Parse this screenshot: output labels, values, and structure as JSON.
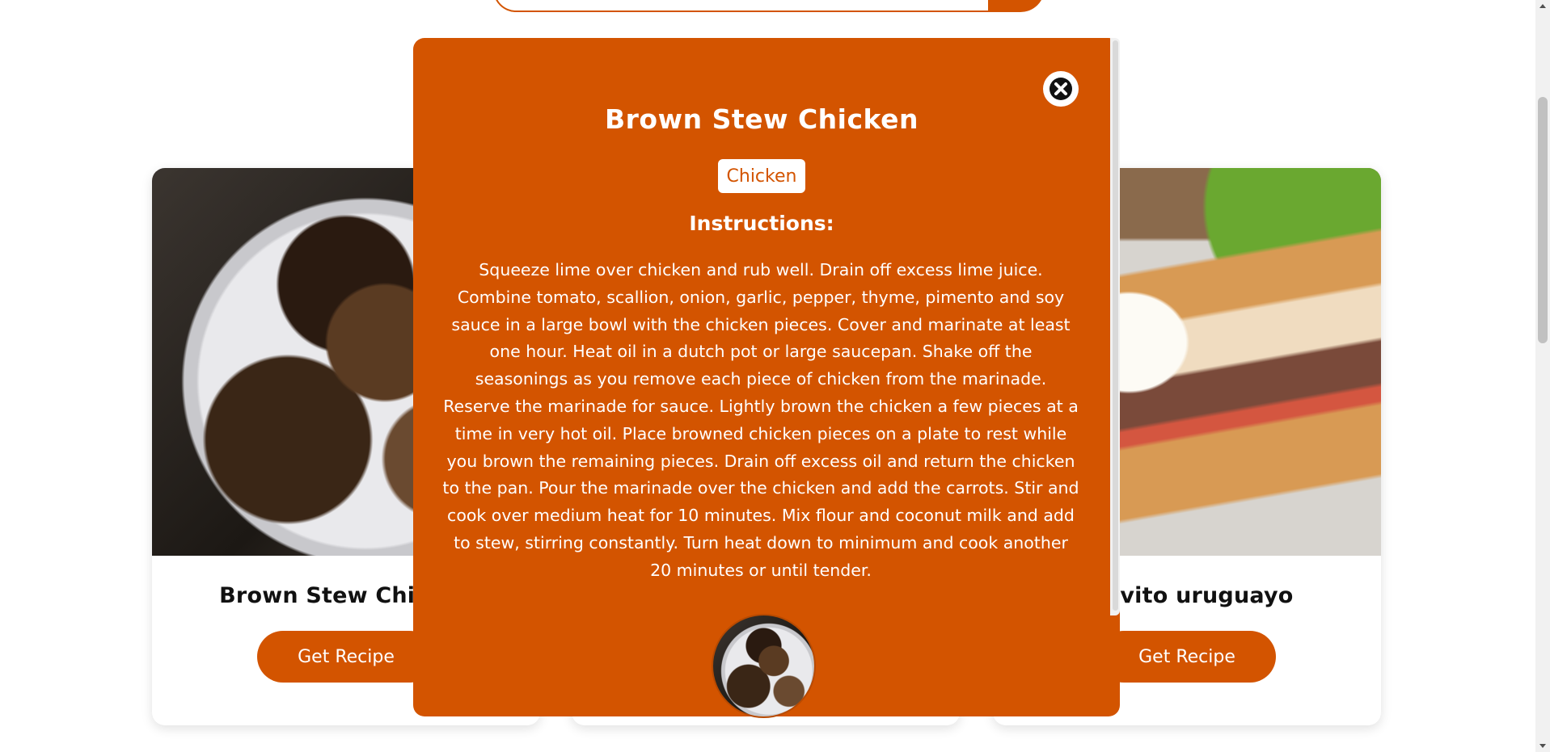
{
  "cards": [
    {
      "title": "Brown Stew Chicken",
      "button": "Get Recipe"
    },
    {
      "title": "Chivito uruguayo",
      "button": "Get Recipe"
    }
  ],
  "modal": {
    "title": "Brown Stew Chicken",
    "category": "Chicken",
    "instructions_heading": "Instructions:",
    "instructions": "Squeeze lime over chicken and rub well. Drain off excess lime juice. Combine tomato, scallion, onion, garlic, pepper, thyme, pimento and soy sauce in a large bowl with the chicken pieces. Cover and marinate at least one hour. Heat oil in a dutch pot or large saucepan. Shake off the seasonings as you remove each piece of chicken from the marinade. Reserve the marinade for sauce. Lightly brown the chicken a few pieces at a time in very hot oil. Place browned chicken pieces on a plate to rest while you brown the remaining pieces. Drain off excess oil and return the chicken to the pan. Pour the marinade over the chicken and add the carrots. Stir and cook over medium heat for 10 minutes. Mix flour and coconut milk and add to stew, stirring constantly. Turn heat down to minimum and cook another 20 minutes or until tender.",
    "close_icon": "close-icon"
  },
  "colors": {
    "accent": "#d35400",
    "text_dark": "#111111",
    "white": "#ffffff"
  }
}
